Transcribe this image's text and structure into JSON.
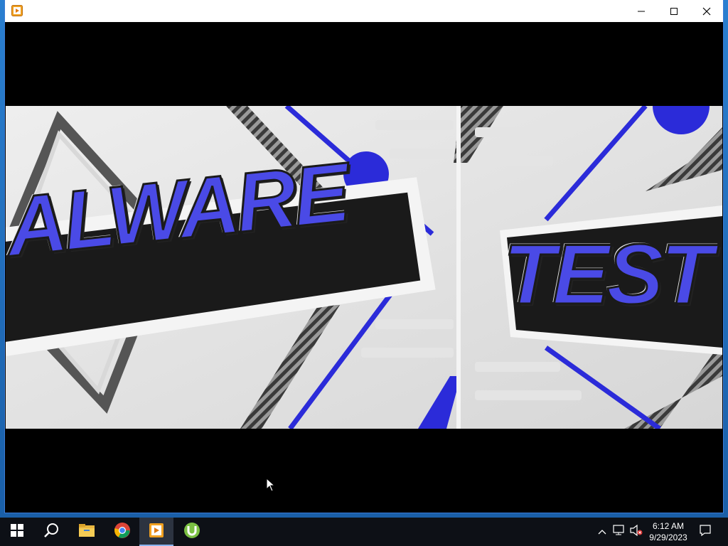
{
  "window": {
    "title": "",
    "app_icon": "media-player-icon",
    "controls": [
      "minimize-icon",
      "maximize-icon",
      "close-icon"
    ]
  },
  "video": {
    "frame_text_left": "ALWARE",
    "frame_text_right": "TEST"
  },
  "taskbar": {
    "apps": [
      {
        "name": "start-button",
        "icon": "windows-logo-icon"
      },
      {
        "name": "search-button",
        "icon": "search-icon"
      },
      {
        "name": "file-explorer",
        "icon": "folder-icon"
      },
      {
        "name": "chrome",
        "icon": "chrome-icon"
      },
      {
        "name": "media-player",
        "icon": "media-player-icon",
        "active": true
      },
      {
        "name": "utorrent",
        "icon": "utorrent-icon"
      }
    ],
    "tray": {
      "icons": [
        "chevron-up-icon",
        "network-icon",
        "volume-muted-icon"
      ],
      "time": "6:12 AM",
      "date": "9/29/2023",
      "notification_icon": "notification-icon"
    }
  },
  "colors": {
    "accent_blue": "#2b2bd9",
    "taskbar_bg": "#0d1016",
    "utorrent_green": "#7bc043"
  }
}
